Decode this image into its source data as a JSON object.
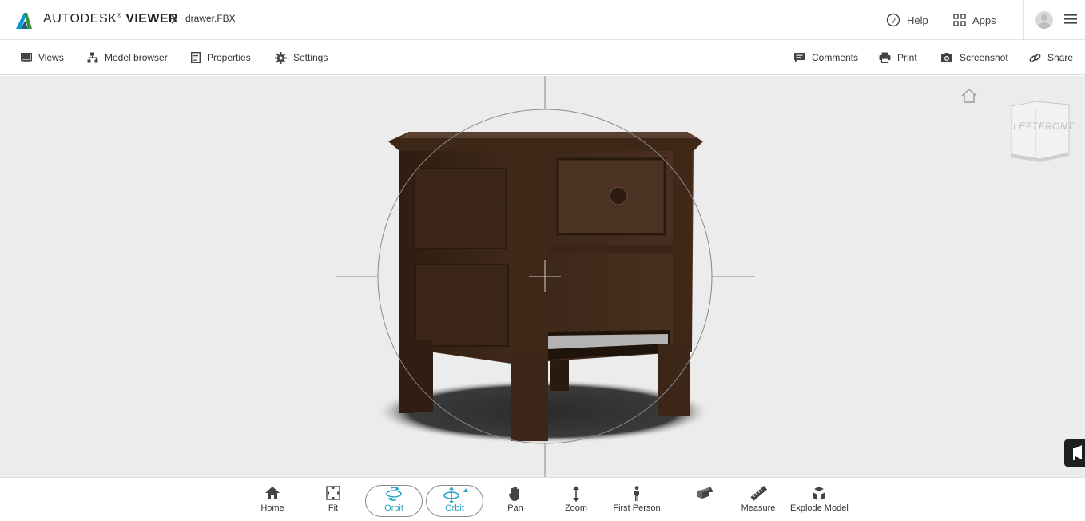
{
  "header": {
    "brand_prefix": "AUTODESK",
    "brand_mark": "®",
    "brand_suffix": "VIEWER",
    "breadcrumb_separator_icon": "chevron-right-icon",
    "file_name": "drawer.FBX",
    "help_label": "Help",
    "apps_label": "Apps"
  },
  "toolbar": {
    "views_label": "Views",
    "model_browser_label": "Model browser",
    "properties_label": "Properties",
    "settings_label": "Settings",
    "comments_label": "Comments",
    "print_label": "Print",
    "screenshot_label": "Screenshot",
    "share_label": "Share"
  },
  "viewcube": {
    "left_label": "LEFT",
    "front_label": "FRONT"
  },
  "bottom_tools": {
    "home": "Home",
    "fit": "Fit",
    "orbit1": "Orbit",
    "orbit2": "Orbit",
    "pan": "Pan",
    "zoom": "Zoom",
    "first_person": "First Person",
    "section": "",
    "measure": "Measure",
    "explode": "Explode Model"
  },
  "colors": {
    "accent": "#27a3c5",
    "viewport_bg": "#ececec",
    "wood_dark": "#3a2516"
  }
}
